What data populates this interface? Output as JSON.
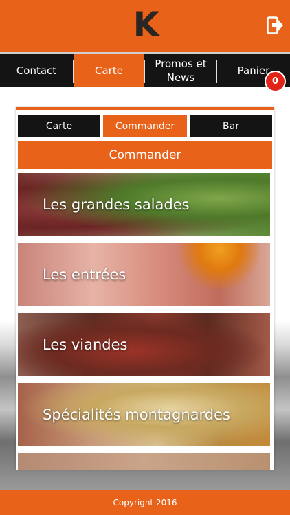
{
  "header": {
    "logo_letter": "K",
    "logout_icon": "logout-icon"
  },
  "nav": {
    "items": [
      {
        "label": "Contact"
      },
      {
        "label": "Carte",
        "active": true
      },
      {
        "label": "Promos et\nNews"
      },
      {
        "label": "Panier"
      }
    ],
    "cart_count": "0"
  },
  "panel": {
    "tabs": [
      {
        "label": "Carte"
      },
      {
        "label": "Commander",
        "active": true
      },
      {
        "label": "Bar"
      }
    ],
    "title": "Commander",
    "categories": [
      {
        "label": "Les grandes salades"
      },
      {
        "label": "Les entrées"
      },
      {
        "label": "Les viandes"
      },
      {
        "label": "Spécialités montagnardes"
      },
      {
        "label": ""
      }
    ]
  },
  "footer": {
    "copyright": "Copyright 2016"
  },
  "colors": {
    "accent": "#e8621a",
    "nav_bg": "#141414",
    "badge": "#e02418"
  }
}
